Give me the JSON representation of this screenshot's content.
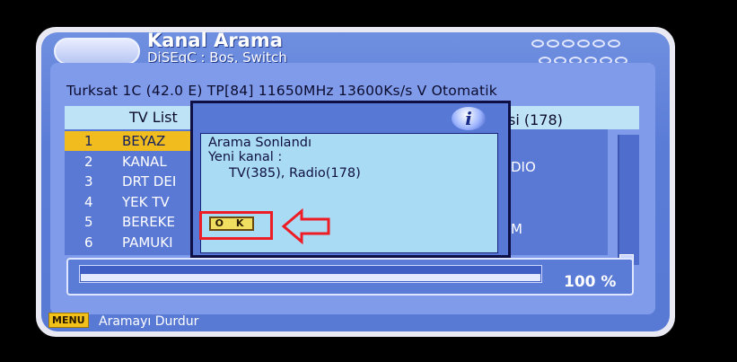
{
  "header": {
    "title": "Kanal Arama",
    "subtitle": "DiSEqC : Boş, Switch"
  },
  "satellite_line": "Turksat 1C (42.0 E) TP[84] 11650MHz 13600Ks/s V Otomatik",
  "tabs": {
    "tv_label": "TV List",
    "radio_label": "si (178)"
  },
  "tv_channels": [
    {
      "num": "1",
      "name": "BEYAZ"
    },
    {
      "num": "2",
      "name": "KANAL"
    },
    {
      "num": "3",
      "name": "DRT DEI"
    },
    {
      "num": "4",
      "name": "YEK TV"
    },
    {
      "num": "5",
      "name": "BEREKE"
    },
    {
      "num": "6",
      "name": "PAMUKI"
    }
  ],
  "radio_fragments": [
    "DIO",
    "M"
  ],
  "progress": {
    "value": 1.0,
    "label": "100 %"
  },
  "footer": {
    "menu_key": "MENU",
    "hint": "Aramayı Durdur"
  },
  "dialog": {
    "icon": "info-icon",
    "line1": "Arama Sonlandı",
    "line2": "Yeni kanal :",
    "line3": "TV(385), Radio(178)",
    "ok_label": "O K"
  },
  "colors": {
    "background": "#5a7bd6",
    "selection": "#f0bc1e",
    "highlight": "#ee1c24",
    "dialog_body": "#a9dcf4"
  }
}
